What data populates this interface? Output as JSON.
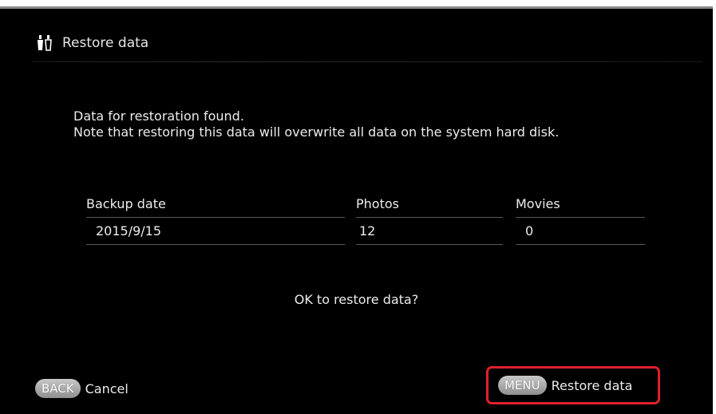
{
  "header": {
    "title": "Restore data",
    "icon": "restore-data-icon"
  },
  "message": {
    "line1": "Data for restoration found.",
    "line2": "Note that restoring this data will overwrite all data on the system hard disk."
  },
  "table": {
    "columns": [
      "Backup date",
      "Photos",
      "Movies"
    ],
    "rows": [
      [
        "2015/9/15",
        "12",
        "0"
      ]
    ]
  },
  "confirm_text": "OK to restore data?",
  "footer": {
    "back": {
      "key": "BACK",
      "label": "Cancel"
    },
    "menu": {
      "key": "MENU",
      "label": "Restore data",
      "highlight_color": "#e0202a"
    }
  }
}
